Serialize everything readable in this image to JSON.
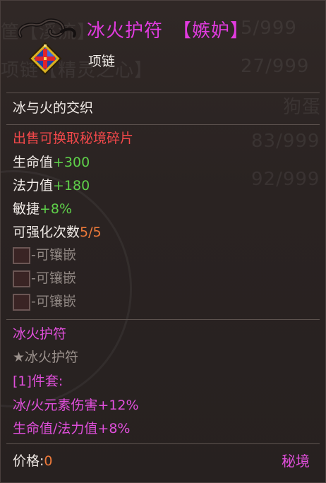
{
  "item": {
    "name": "冰火护符",
    "tag": "【嫉妒】",
    "type": "项链",
    "description": "冰与火的交织",
    "sell_note": "出售可换取秘境碎片"
  },
  "stats": [
    {
      "label": "生命值",
      "value": "+300"
    },
    {
      "label": "法力值",
      "value": "+180"
    },
    {
      "label": "敏捷",
      "value": "+8%"
    }
  ],
  "enhance": {
    "label": "可强化次数",
    "value": "5/5"
  },
  "sockets": [
    {
      "label": "-可镶嵌"
    },
    {
      "label": "-可镶嵌"
    },
    {
      "label": "-可镶嵌"
    }
  ],
  "set": {
    "name": "冰火护符",
    "member": "★冰火护符",
    "bonus_header": "[1]件套:",
    "bonuses": [
      "冰/火元素伤害+12%",
      "生命值/法力值+8%"
    ]
  },
  "price": {
    "label": "价格:",
    "value": "0"
  },
  "region": "秘境",
  "colors": {
    "title": "#e23be0",
    "set": "#e04fdb",
    "bonus_green": "#5fd14a",
    "warning_red": "#f2484a",
    "enhance_orange": "#ee7a3a"
  }
}
